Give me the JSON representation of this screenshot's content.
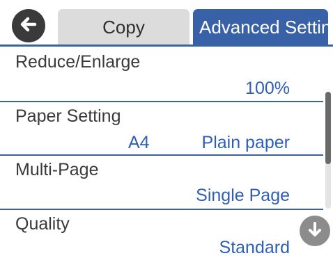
{
  "header": {
    "back_icon": "arrow-left-icon",
    "tabs": [
      {
        "label": "Copy",
        "active": false
      },
      {
        "label": "Advanced Setting",
        "active": true
      }
    ]
  },
  "settings": [
    {
      "label": "Reduce/Enlarge",
      "values": [
        "100%"
      ]
    },
    {
      "label": "Paper Setting",
      "values": [
        "A4",
        "Plain paper"
      ]
    },
    {
      "label": "Multi-Page",
      "values": [
        "Single Page"
      ]
    },
    {
      "label": "Quality",
      "values": [
        "Standard"
      ]
    }
  ],
  "scroll": {
    "down_icon": "arrow-down-icon"
  },
  "colors": {
    "accent": "#3861a8",
    "value_text": "#2f5fb5",
    "tab_inactive": "#dcdcdc"
  }
}
